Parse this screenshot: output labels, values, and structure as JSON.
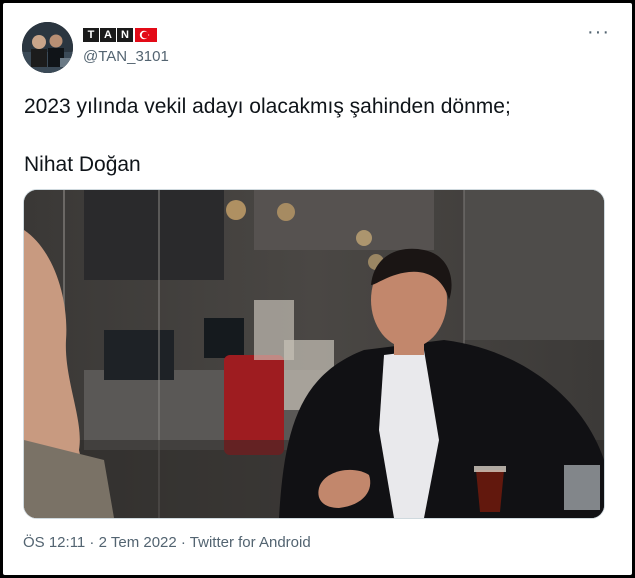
{
  "author": {
    "logo_letters": [
      "T",
      "A",
      "N"
    ],
    "handle": "@TAN_3101"
  },
  "tweet": {
    "line1": "2023 yılında vekil adayı olacakmış şahinden dönme;",
    "line2": "Nihat Doğan"
  },
  "more_menu": "···",
  "footer": {
    "time": "ÖS 12:11",
    "separator": " · ",
    "date": "2 Tem 2022",
    "app": "Twitter for Android"
  },
  "icons": {
    "flag": "turkey-flag-icon",
    "more": "more-dots-icon"
  },
  "colors": {
    "text": "#0f1419",
    "secondary": "#536471",
    "flag_red": "#e30a17"
  }
}
